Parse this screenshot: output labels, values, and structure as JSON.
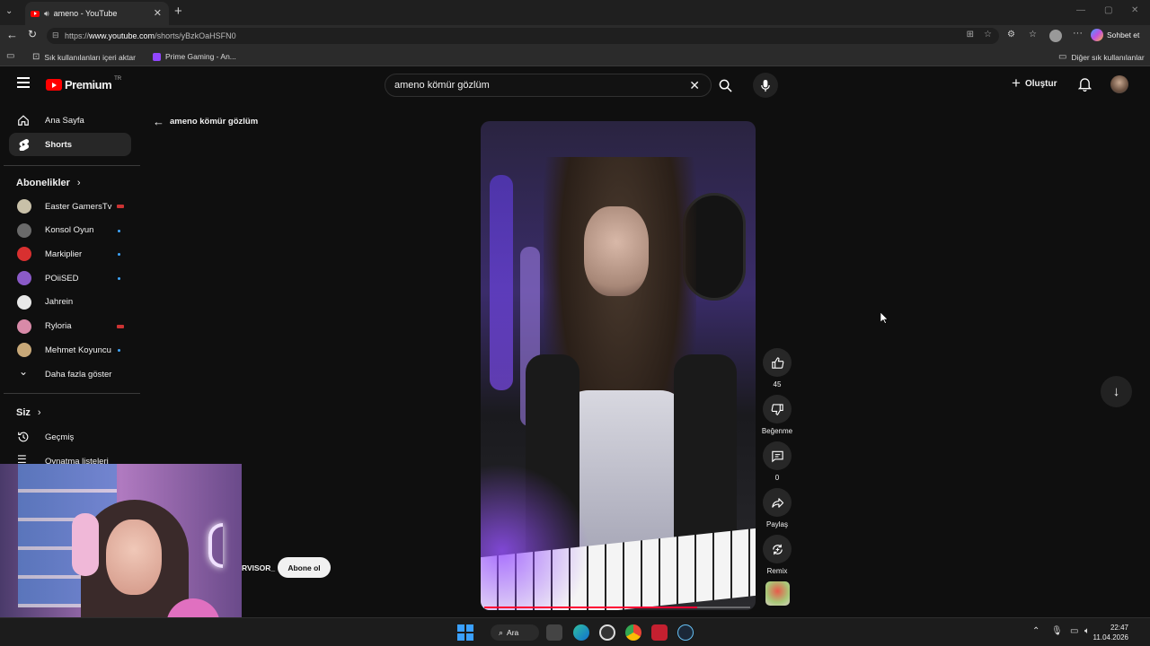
{
  "browser": {
    "tab_title": "ameno - YouTube",
    "url_prefix": "https://",
    "url_host": "www.youtube.com",
    "url_path": "/shorts/yBzkOaHSFN0",
    "copilot_label": "Sohbet et",
    "bookmarks": {
      "import": "Sık kullanılanları içeri aktar",
      "prime": "Prime Gaming - An...",
      "other": "Diğer sık kullanılanlar"
    }
  },
  "youtube": {
    "logo_text": "Premium",
    "logo_region": "TR",
    "search_value": "ameno kömür gözlüm",
    "create_label": "Oluştur",
    "back_query": "ameno kömür gözlüm"
  },
  "sidebar": {
    "home": "Ana Sayfa",
    "shorts": "Shorts",
    "subscriptions_header": "Abonelikler",
    "subscriptions": [
      {
        "name": "Easter GamersTv",
        "avatar_color": "#c8c0a8",
        "status": "live"
      },
      {
        "name": "Konsol Oyun",
        "avatar_color": "#6a6a6a",
        "status": "dot"
      },
      {
        "name": "Markiplier",
        "avatar_color": "#d83030",
        "status": "dot"
      },
      {
        "name": "POiiSED",
        "avatar_color": "#8a5ac8",
        "status": "dot"
      },
      {
        "name": "Jahrein",
        "avatar_color": "#e8e8e8",
        "status": ""
      },
      {
        "name": "Ryloria",
        "avatar_color": "#d88aa8",
        "status": "live"
      },
      {
        "name": "Mehmet Koyuncu",
        "avatar_color": "#c8a878",
        "status": "dot"
      }
    ],
    "show_more": "Daha fazla göster",
    "you_header": "Siz",
    "history": "Geçmiş",
    "playlists": "Oynatma listeleri"
  },
  "short": {
    "likes": "45",
    "dislike_label": "Beğenme",
    "comments": "0",
    "share_label": "Paylaş",
    "remix_label": "Remix",
    "channel_partial": "RVISOR_",
    "subscribe_label": "Abone ol"
  },
  "taskbar": {
    "search_label": "Ara",
    "time": "22:47",
    "date": "11.04.2026"
  }
}
